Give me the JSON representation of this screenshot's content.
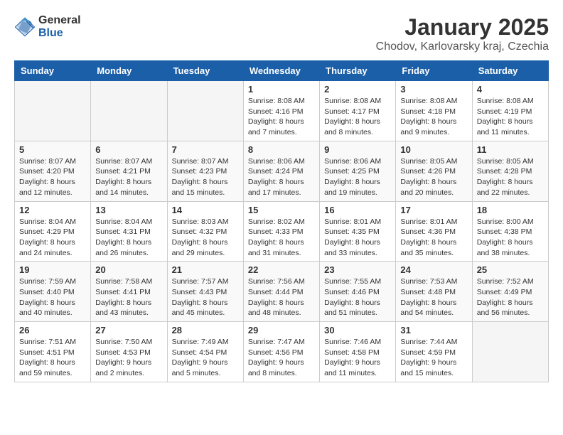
{
  "logo": {
    "general": "General",
    "blue": "Blue"
  },
  "header": {
    "title": "January 2025",
    "location": "Chodov, Karlovarsky kraj, Czechia"
  },
  "weekdays": [
    "Sunday",
    "Monday",
    "Tuesday",
    "Wednesday",
    "Thursday",
    "Friday",
    "Saturday"
  ],
  "weeks": [
    [
      {
        "day": "",
        "info": ""
      },
      {
        "day": "",
        "info": ""
      },
      {
        "day": "",
        "info": ""
      },
      {
        "day": "1",
        "info": "Sunrise: 8:08 AM\nSunset: 4:16 PM\nDaylight: 8 hours\nand 7 minutes."
      },
      {
        "day": "2",
        "info": "Sunrise: 8:08 AM\nSunset: 4:17 PM\nDaylight: 8 hours\nand 8 minutes."
      },
      {
        "day": "3",
        "info": "Sunrise: 8:08 AM\nSunset: 4:18 PM\nDaylight: 8 hours\nand 9 minutes."
      },
      {
        "day": "4",
        "info": "Sunrise: 8:08 AM\nSunset: 4:19 PM\nDaylight: 8 hours\nand 11 minutes."
      }
    ],
    [
      {
        "day": "5",
        "info": "Sunrise: 8:07 AM\nSunset: 4:20 PM\nDaylight: 8 hours\nand 12 minutes."
      },
      {
        "day": "6",
        "info": "Sunrise: 8:07 AM\nSunset: 4:21 PM\nDaylight: 8 hours\nand 14 minutes."
      },
      {
        "day": "7",
        "info": "Sunrise: 8:07 AM\nSunset: 4:23 PM\nDaylight: 8 hours\nand 15 minutes."
      },
      {
        "day": "8",
        "info": "Sunrise: 8:06 AM\nSunset: 4:24 PM\nDaylight: 8 hours\nand 17 minutes."
      },
      {
        "day": "9",
        "info": "Sunrise: 8:06 AM\nSunset: 4:25 PM\nDaylight: 8 hours\nand 19 minutes."
      },
      {
        "day": "10",
        "info": "Sunrise: 8:05 AM\nSunset: 4:26 PM\nDaylight: 8 hours\nand 20 minutes."
      },
      {
        "day": "11",
        "info": "Sunrise: 8:05 AM\nSunset: 4:28 PM\nDaylight: 8 hours\nand 22 minutes."
      }
    ],
    [
      {
        "day": "12",
        "info": "Sunrise: 8:04 AM\nSunset: 4:29 PM\nDaylight: 8 hours\nand 24 minutes."
      },
      {
        "day": "13",
        "info": "Sunrise: 8:04 AM\nSunset: 4:31 PM\nDaylight: 8 hours\nand 26 minutes."
      },
      {
        "day": "14",
        "info": "Sunrise: 8:03 AM\nSunset: 4:32 PM\nDaylight: 8 hours\nand 29 minutes."
      },
      {
        "day": "15",
        "info": "Sunrise: 8:02 AM\nSunset: 4:33 PM\nDaylight: 8 hours\nand 31 minutes."
      },
      {
        "day": "16",
        "info": "Sunrise: 8:01 AM\nSunset: 4:35 PM\nDaylight: 8 hours\nand 33 minutes."
      },
      {
        "day": "17",
        "info": "Sunrise: 8:01 AM\nSunset: 4:36 PM\nDaylight: 8 hours\nand 35 minutes."
      },
      {
        "day": "18",
        "info": "Sunrise: 8:00 AM\nSunset: 4:38 PM\nDaylight: 8 hours\nand 38 minutes."
      }
    ],
    [
      {
        "day": "19",
        "info": "Sunrise: 7:59 AM\nSunset: 4:40 PM\nDaylight: 8 hours\nand 40 minutes."
      },
      {
        "day": "20",
        "info": "Sunrise: 7:58 AM\nSunset: 4:41 PM\nDaylight: 8 hours\nand 43 minutes."
      },
      {
        "day": "21",
        "info": "Sunrise: 7:57 AM\nSunset: 4:43 PM\nDaylight: 8 hours\nand 45 minutes."
      },
      {
        "day": "22",
        "info": "Sunrise: 7:56 AM\nSunset: 4:44 PM\nDaylight: 8 hours\nand 48 minutes."
      },
      {
        "day": "23",
        "info": "Sunrise: 7:55 AM\nSunset: 4:46 PM\nDaylight: 8 hours\nand 51 minutes."
      },
      {
        "day": "24",
        "info": "Sunrise: 7:53 AM\nSunset: 4:48 PM\nDaylight: 8 hours\nand 54 minutes."
      },
      {
        "day": "25",
        "info": "Sunrise: 7:52 AM\nSunset: 4:49 PM\nDaylight: 8 hours\nand 56 minutes."
      }
    ],
    [
      {
        "day": "26",
        "info": "Sunrise: 7:51 AM\nSunset: 4:51 PM\nDaylight: 8 hours\nand 59 minutes."
      },
      {
        "day": "27",
        "info": "Sunrise: 7:50 AM\nSunset: 4:53 PM\nDaylight: 9 hours\nand 2 minutes."
      },
      {
        "day": "28",
        "info": "Sunrise: 7:49 AM\nSunset: 4:54 PM\nDaylight: 9 hours\nand 5 minutes."
      },
      {
        "day": "29",
        "info": "Sunrise: 7:47 AM\nSunset: 4:56 PM\nDaylight: 9 hours\nand 8 minutes."
      },
      {
        "day": "30",
        "info": "Sunrise: 7:46 AM\nSunset: 4:58 PM\nDaylight: 9 hours\nand 11 minutes."
      },
      {
        "day": "31",
        "info": "Sunrise: 7:44 AM\nSunset: 4:59 PM\nDaylight: 9 hours\nand 15 minutes."
      },
      {
        "day": "",
        "info": ""
      }
    ]
  ]
}
